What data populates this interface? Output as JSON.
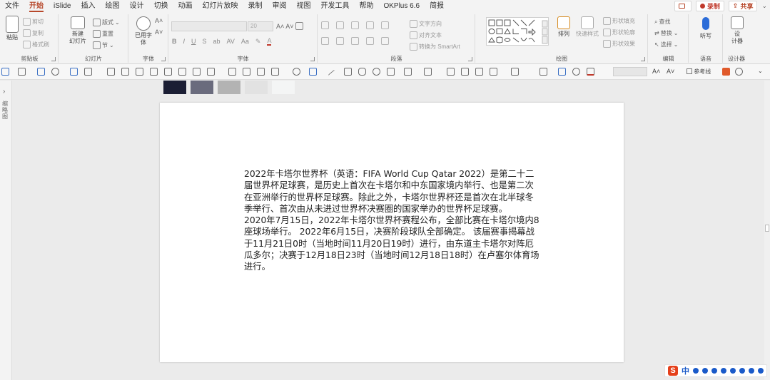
{
  "menu": {
    "tabs": [
      "文件",
      "开始",
      "iSlide",
      "插入",
      "绘图",
      "设计",
      "切换",
      "动画",
      "幻灯片放映",
      "录制",
      "审阅",
      "视图",
      "开发工具",
      "帮助",
      "OKPlus 6.6",
      "简报"
    ],
    "active_tab": "开始",
    "comment_label": "",
    "record_label": "录制",
    "share_label": "共享"
  },
  "ribbon": {
    "clipboard": {
      "paste": "粘贴",
      "cut": "剪切",
      "copy": "复制",
      "format_painter": "格式刷",
      "group_label": "剪贴板"
    },
    "slides": {
      "new_slide": "新建\n幻灯片",
      "layout": "版式",
      "reset": "重置",
      "section": "节",
      "group_label": "幻灯片"
    },
    "font_group": {
      "used_font": "已用字\n体",
      "group_label": "字体"
    },
    "font": {
      "font_name": "",
      "font_size": "20",
      "bold": "B",
      "italic": "I",
      "underline": "U",
      "strike": "S",
      "text_direction": "文字方向",
      "align_text": "对齐文本",
      "smartart": "转换为 SmartArt",
      "group_label": "字体"
    },
    "paragraph": {
      "group_label": "段落"
    },
    "drawing": {
      "arrange": "排列",
      "quick_styles": "快速样式",
      "shape_fill": "形状填充",
      "shape_outline": "形状轮廓",
      "shape_effects": "形状效果",
      "group_label": "绘图"
    },
    "editing": {
      "find": "查找",
      "replace": "替换",
      "select": "选择",
      "group_label": "编辑"
    },
    "voice": {
      "dictate": "听写",
      "group_label": "语音"
    },
    "designer": {
      "label": "设\n计器",
      "group_label": "设计器"
    }
  },
  "qat": {
    "guides_label": "参考线"
  },
  "sidebar": {
    "collapse": "›",
    "vertical_label": "缩略图"
  },
  "swatch_colors": [
    "#1b1e34",
    "#6a6b7d",
    "#b3b3b3",
    "#e2e2e2",
    "#f4f5f5"
  ],
  "slide": {
    "paragraphs": [
      "2022年卡塔尔世界杯（英语：FIFA World Cup Qatar 2022）是第二十二届世界杯足球赛，是历史上首次在卡塔尔和中东国家境内举行、也是第二次在亚洲举行的世界杯足球赛。除此之外，卡塔尔世界杯还是首次在北半球冬季举行、首次由从未进过世界杯决赛圈的国家举办的世界杯足球赛。",
      "2020年7月15日，2022年卡塔尔世界杯赛程公布，全部比赛在卡塔尔境内8座球场举行。 2022年6月15日，决赛阶段球队全部确定。 该届赛事揭幕战于11月21日0时（当地时间11月20日19时）进行，由东道主卡塔尔对阵厄瓜多尔；决赛于12月18日23时（当地时间12月18日18时）在卢塞尔体育场进行。"
    ]
  },
  "ime": {
    "logo": "S",
    "mode": "中"
  }
}
